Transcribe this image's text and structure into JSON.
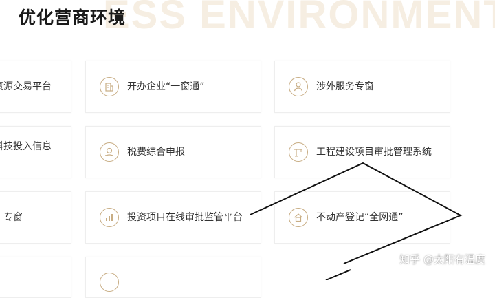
{
  "section": {
    "title": "优化营商环境",
    "bg_watermark": "ESS ENVIRONMENT"
  },
  "cards": [
    {
      "label": "资源交易平台",
      "icon": "none"
    },
    {
      "label": "开办企业“一窗通”",
      "icon": "building-icon"
    },
    {
      "label": "涉外服务专窗",
      "icon": "person-icon"
    },
    {
      "label": "科技投入信息",
      "icon": "none"
    },
    {
      "label": "税费综合申报",
      "icon": "money-hand-icon"
    },
    {
      "label": "工程建设项目审批管理系统",
      "icon": "crane-icon"
    },
    {
      "label": "专窗",
      "icon": "none"
    },
    {
      "label": "投资项目在线审批监管平台",
      "icon": "chart-icon"
    },
    {
      "label": "不动产登记“全网通”",
      "icon": "house-icon"
    }
  ],
  "credit": "知乎 @太阳有温度",
  "colors": {
    "accent": "#c8ad84",
    "title": "#1a1a1a",
    "card_border": "#eeeeee"
  }
}
